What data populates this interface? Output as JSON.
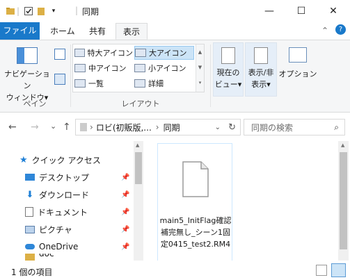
{
  "window": {
    "title": "同期",
    "minimize_glyph": "—",
    "maximize_glyph": "☐",
    "close_glyph": "✕"
  },
  "ribbon_tabs": [
    {
      "label": "ファイル"
    },
    {
      "label": "ホーム"
    },
    {
      "label": "共有"
    },
    {
      "label": "表示"
    }
  ],
  "ribbon": {
    "pane_group": {
      "nav_pane_label": "ナビゲーション\nウィンドウ▾",
      "group_label": "ペイン"
    },
    "layout_group": {
      "items": [
        {
          "label": "特大アイコン",
          "selected": false
        },
        {
          "label": "大アイコン",
          "selected": true
        },
        {
          "label": "中アイコン",
          "selected": false
        },
        {
          "label": "小アイコン",
          "selected": false
        },
        {
          "label": "一覧",
          "selected": false
        },
        {
          "label": "詳細",
          "selected": false
        }
      ],
      "group_label": "レイアウト"
    },
    "current_view_label": "現在の\nビュー▾",
    "show_hide_label": "表示/非\n表示▾",
    "options_label": "オプション"
  },
  "navbar": {
    "back_glyph": "←",
    "forward_glyph": "→",
    "dropdown_glyph": "⌄",
    "up_glyph": "↑",
    "breadcrumb": [
      "ロビ(初販版,...",
      "同期"
    ],
    "breadcrumb_sep": "›",
    "refresh_glyph": "↻",
    "search_placeholder": "同期の検索"
  },
  "nav_pane": {
    "items": [
      {
        "label": "クイック アクセス",
        "icon": "star-icon",
        "pinned": false
      },
      {
        "label": "デスクトップ",
        "icon": "desktop-icon",
        "pinned": true
      },
      {
        "label": "ダウンロード",
        "icon": "download-icon",
        "pinned": true
      },
      {
        "label": "ドキュメント",
        "icon": "document-icon",
        "pinned": true
      },
      {
        "label": "ピクチャ",
        "icon": "picture-icon",
        "pinned": true
      },
      {
        "label": "OneDrive",
        "icon": "cloud-icon",
        "pinned": true
      },
      {
        "label": "doc",
        "icon": "folder-icon",
        "pinned": false
      }
    ],
    "pin_glyph": "📌"
  },
  "files": [
    {
      "name": "main5_InitFlag確認補完無し_シーン1固定0415_test2.RM4"
    }
  ],
  "status": {
    "item_count": "1 個の項目"
  },
  "colors": {
    "file_tab": "#1979ca",
    "selection": "#cce4f7",
    "ribbon_bg": "#f5f6f7"
  }
}
